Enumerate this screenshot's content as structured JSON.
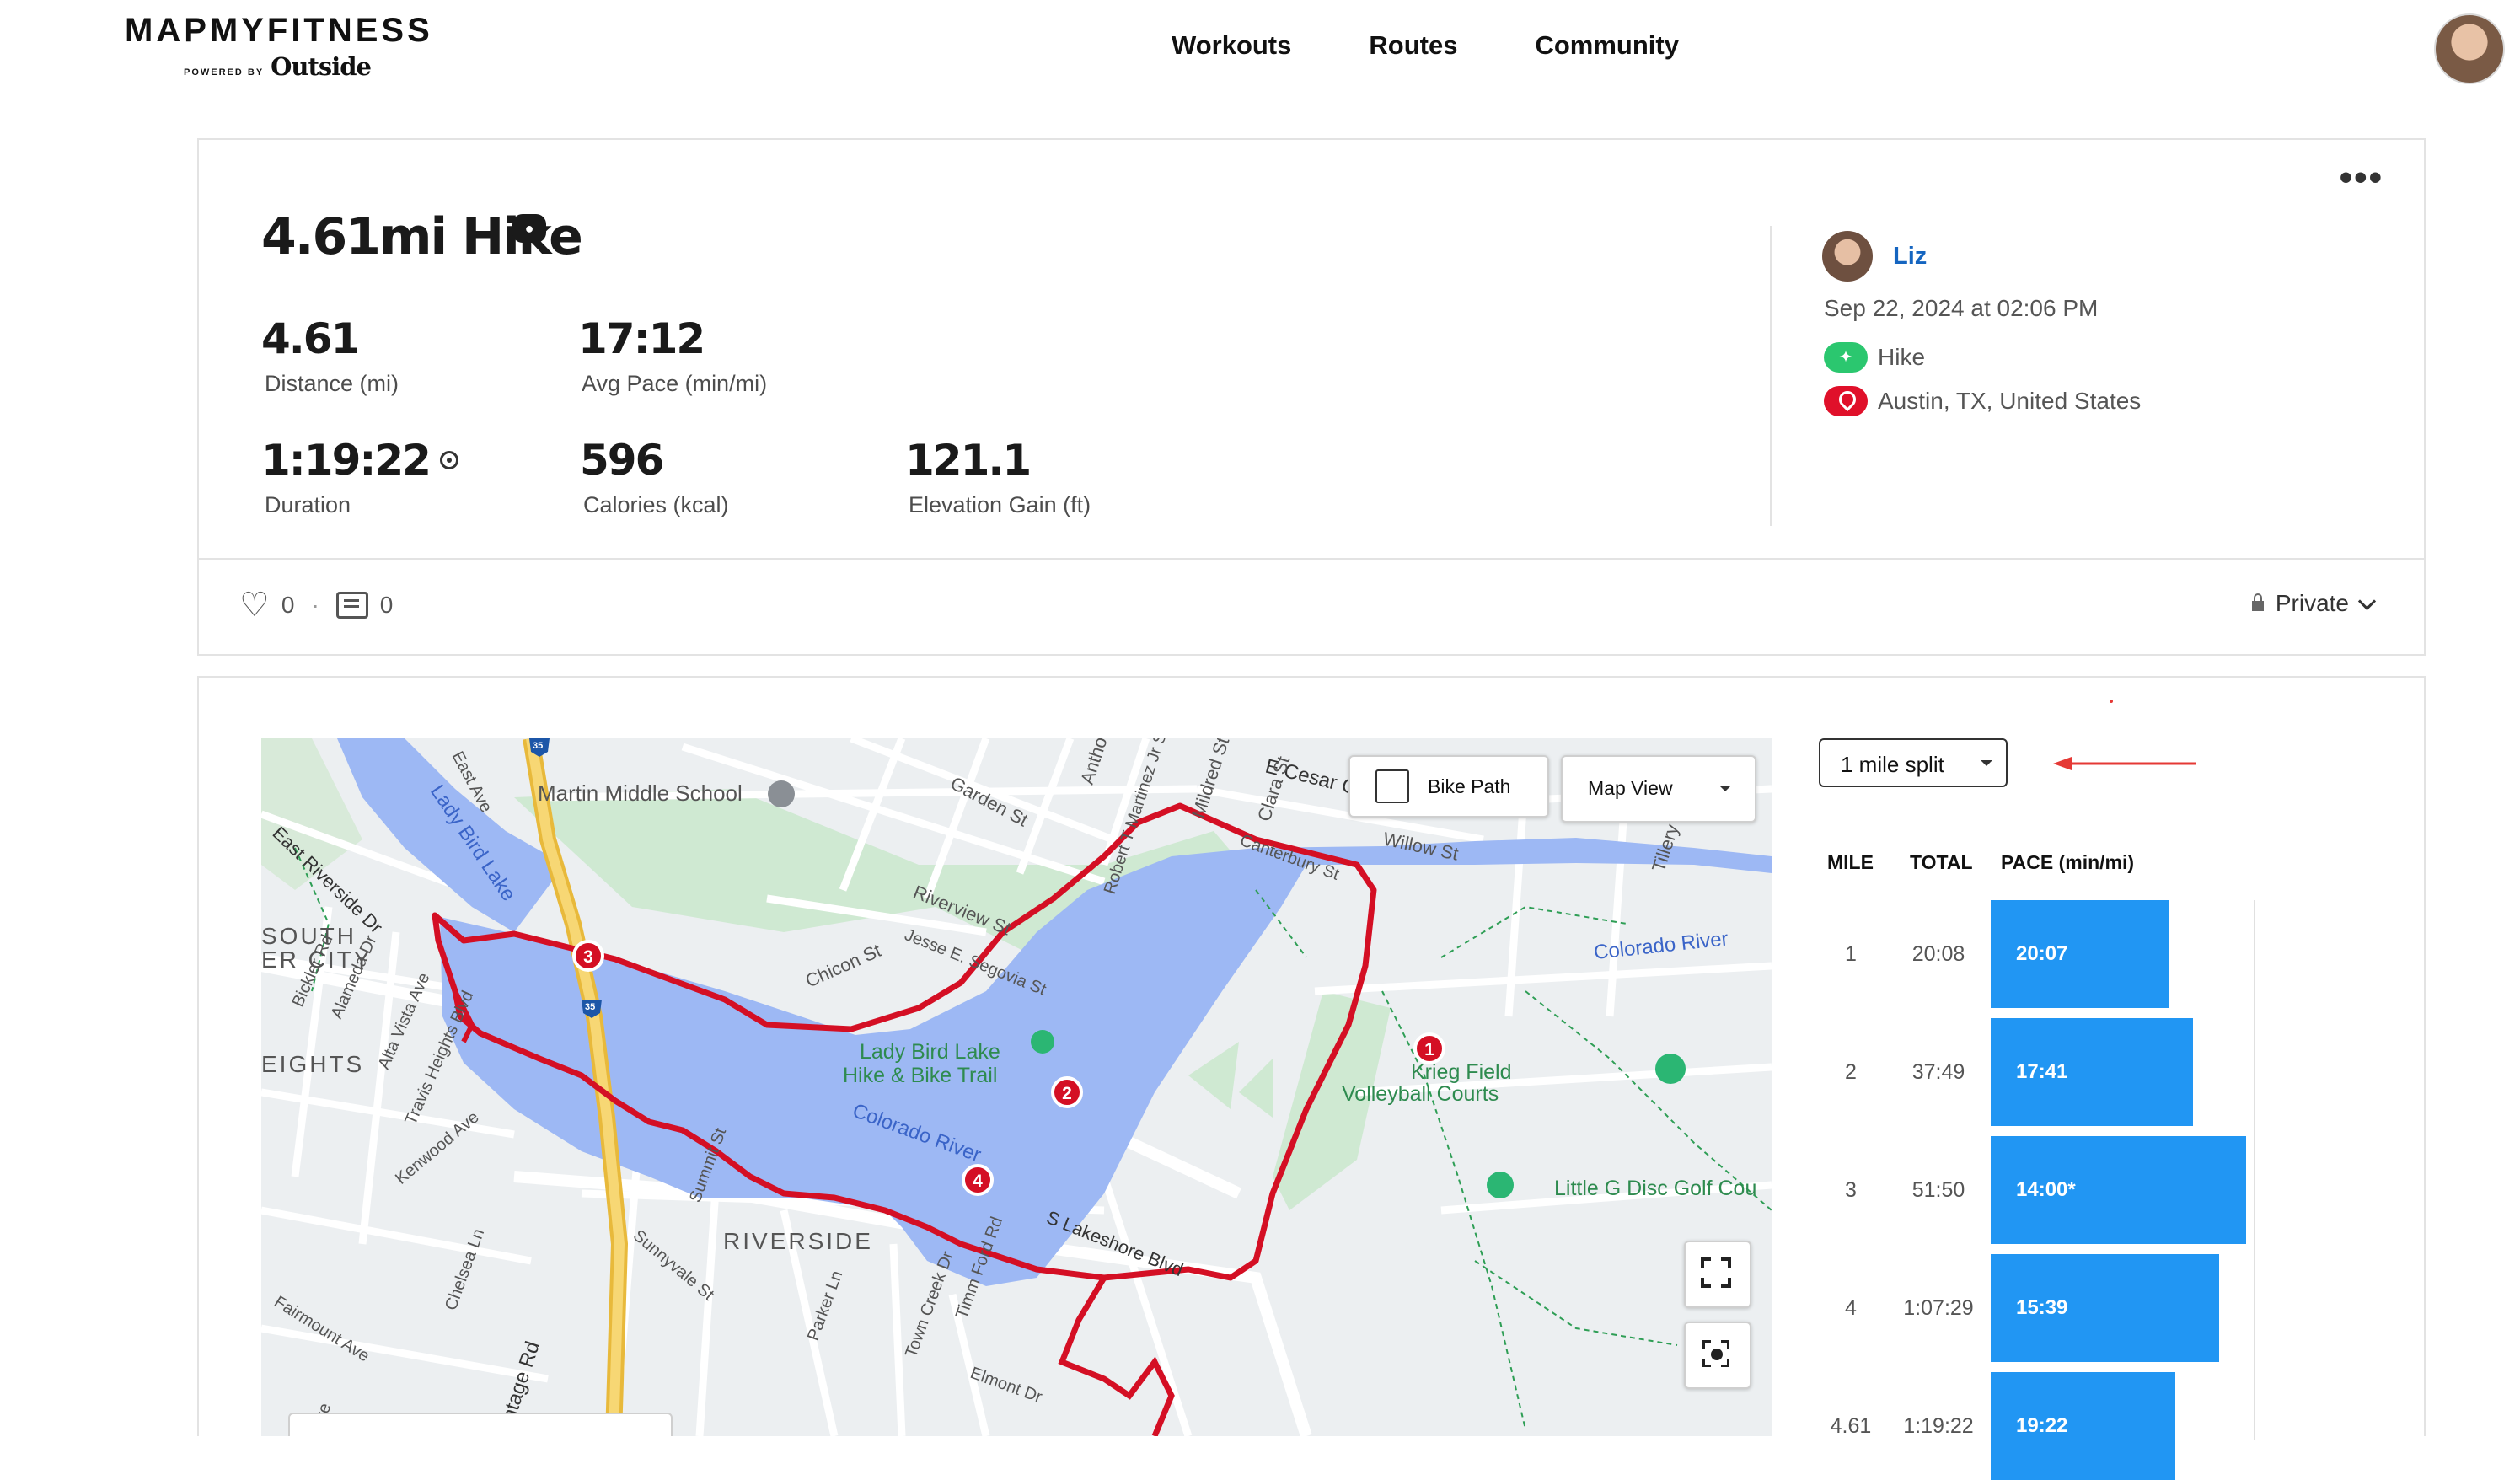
{
  "header": {
    "logo_main": "MAPMYFITNESS",
    "logo_powered": "POWERED BY",
    "logo_outside": "Outside",
    "nav": [
      "Workouts",
      "Routes",
      "Community"
    ]
  },
  "workout": {
    "title": "4.61mi Hike",
    "stats": [
      {
        "value": "4.61",
        "label": "Distance (mi)"
      },
      {
        "value": "17:12",
        "label": "Avg Pace (min/mi)"
      },
      {
        "value": "1:19:22",
        "label": "Duration"
      },
      {
        "value": "596",
        "label": "Calories (kcal)"
      },
      {
        "value": "121.1",
        "label": "Elevation Gain (ft)"
      }
    ],
    "user": "Liz",
    "date": "Sep 22, 2024 at 02:06 PM",
    "activity": "Hike",
    "location": "Austin, TX, United States",
    "likes": "0",
    "comments": "0",
    "privacy": "Private"
  },
  "map": {
    "bike_path_label": "Bike Path",
    "view_label": "Map View",
    "labels": {
      "martin": "Martin Middle School",
      "garden": "Garden St",
      "anthony": "Anthony",
      "robert": "Robert T Martinez Jr St",
      "mildred": "Mildred St",
      "cesar": "E Cesar C",
      "clara": "Clara St",
      "canterbury": "Canterbury St",
      "willow": "Willow St",
      "tillery": "Tillery S",
      "riverview": "Riverview St",
      "segovia": "Jesse E. Segovia St",
      "chicon": "Chicon St",
      "ladybird_lake": "Lady Bird Lake",
      "trail1": "Lady Bird Lake",
      "trail2": "Hike & Bike Trail",
      "colorado": "Colorado River",
      "colorado_r": "Colorado River",
      "krieg1": "Krieg Field",
      "krieg2": "Volleyball Courts",
      "littleg": "Little G Disc Golf Cou",
      "east_riv": "East Riverside Dr",
      "east_ave": "East Ave",
      "bickler": "Bickler Rd",
      "alameda": "Alameda Dr",
      "altavista": "Alta Vista Ave",
      "travis": "Travis Heights Blvd",
      "kenwood": "Kenwood Ave",
      "south": "SOUTH",
      "er_city": "ER CITY",
      "eights": "EIGHTS",
      "summit": "Summit St",
      "sunnyvale": "Sunnyvale St",
      "riverside": "RIVERSIDE",
      "lakeshore": "S Lakeshore Blvd",
      "parker": "Parker Ln",
      "towncreek": "Town Creek Dr",
      "timmford": "Timm Ford Rd",
      "elmont": "Elmont Dr",
      "chelsea": "Chelsea Ln",
      "fairmount": "Fairmount Ave",
      "frontage": "ontage Rd",
      "ave_bottom": "Ave",
      "shield": "35"
    },
    "markers": [
      "1",
      "2",
      "3",
      "4"
    ]
  },
  "splits": {
    "selector": "1 mile split",
    "col_mile": "MILE",
    "col_total": "TOTAL",
    "col_pace": "PACE (min/mi)",
    "rows": [
      {
        "mile": "1",
        "total": "20:08",
        "pace": "20:07",
        "width": 0.421
      },
      {
        "mile": "2",
        "total": "37:49",
        "pace": "17:41",
        "width": 0.479
      },
      {
        "mile": "3",
        "total": "51:50",
        "pace": "14:00*",
        "width": 0.605
      },
      {
        "mile": "4",
        "total": "1:07:29",
        "pace": "15:39",
        "width": 0.541
      },
      {
        "mile": "4.61",
        "total": "1:19:22",
        "pace": "19:22",
        "width": 0.437
      }
    ]
  },
  "colors": {
    "accent": "#1565c0",
    "bar": "#2196f3",
    "route": "#d40f24",
    "activity_pill": "#2bc76f",
    "location_pill": "#e0102a",
    "water": "#9db8f4",
    "park": "#cfe9d2"
  }
}
